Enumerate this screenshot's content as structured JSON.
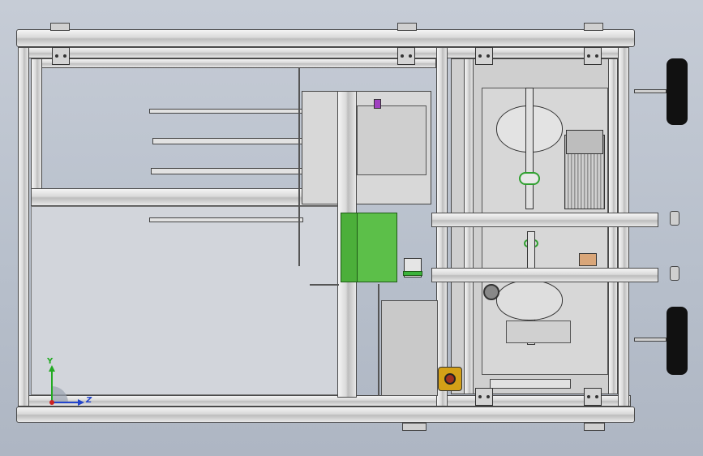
{
  "viewport": {
    "background_colors": [
      "#c6ccd6",
      "#aeb6c3"
    ]
  },
  "model": {
    "accent_green": "#4caf3a",
    "frame_color": "#dcdcdc",
    "knob_color": "#111111",
    "estop_color": "#d4a017"
  },
  "triad": {
    "y_label": "Y",
    "z_label": "Z",
    "y_color": "#22aa22",
    "z_color": "#2244cc",
    "x_color": "#cc2222"
  }
}
